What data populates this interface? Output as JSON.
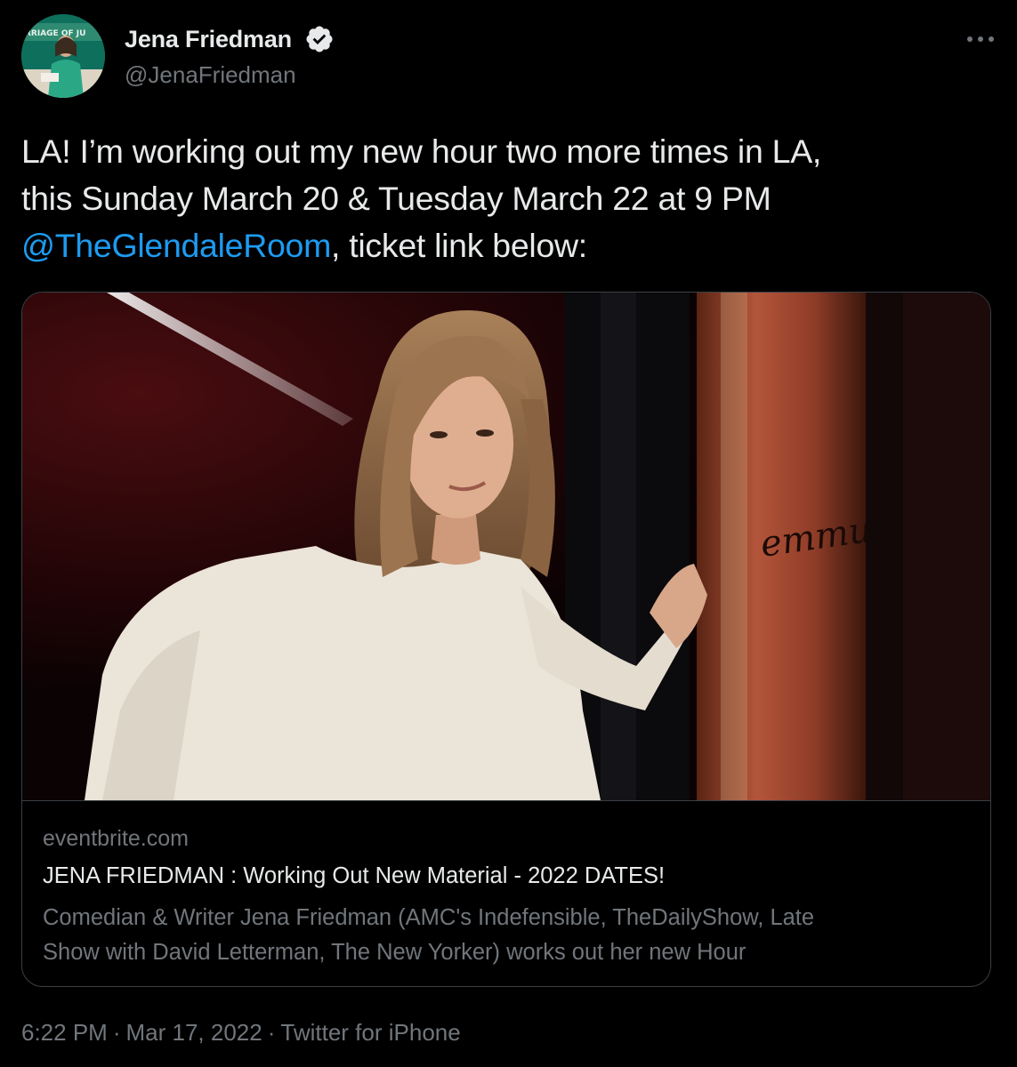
{
  "author": {
    "display_name": "Jena Friedman",
    "handle": "@JenaFriedman",
    "verified_icon": "verified-badge-icon",
    "avatar_banner_text": "RRIAGE OF JU"
  },
  "more_icon": "more-horizontal-icon",
  "tweet": {
    "line1": "LA! I’m working out my new hour two more times in LA,",
    "line2": "this Sunday March 20 & Tuesday March 22 at 9 PM",
    "mention": "@TheGlendaleRoom",
    "line3_rest": ", ticket link below:"
  },
  "card": {
    "image_scrawl_text": "emmutac",
    "domain": "eventbrite.com",
    "title": "JENA FRIEDMAN : Working Out New Material - 2022 DATES!",
    "description_line1": "Comedian & Writer Jena Friedman (AMC's Indefensible, TheDailyShow, Late",
    "description_line2": "Show with David Letterman, The New Yorker) works out her new Hour"
  },
  "meta": {
    "time": "6:22 PM",
    "separator": "·",
    "date": "Mar 17, 2022",
    "source": "Twitter for iPhone"
  },
  "colors": {
    "background": "#000000",
    "primary_text": "#e7e9ea",
    "secondary_text": "#71767b",
    "link": "#1d9bf0",
    "border": "#3a3f44"
  }
}
